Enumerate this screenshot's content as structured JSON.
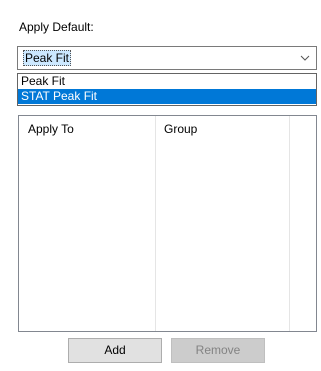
{
  "apply_default": {
    "label": "Apply Default:",
    "selected": "Peak Fit",
    "options": [
      "Peak Fit",
      "STAT Peak Fit"
    ],
    "highlighted_index": 1
  },
  "list": {
    "columns": [
      "Apply To",
      "Group"
    ],
    "rows": []
  },
  "buttons": {
    "add": "Add",
    "remove": "Remove"
  },
  "colors": {
    "selection": "#0078d7",
    "combo_focus": "#cce8ff"
  },
  "icons": {
    "combo_arrow": "chevron-down-icon"
  }
}
